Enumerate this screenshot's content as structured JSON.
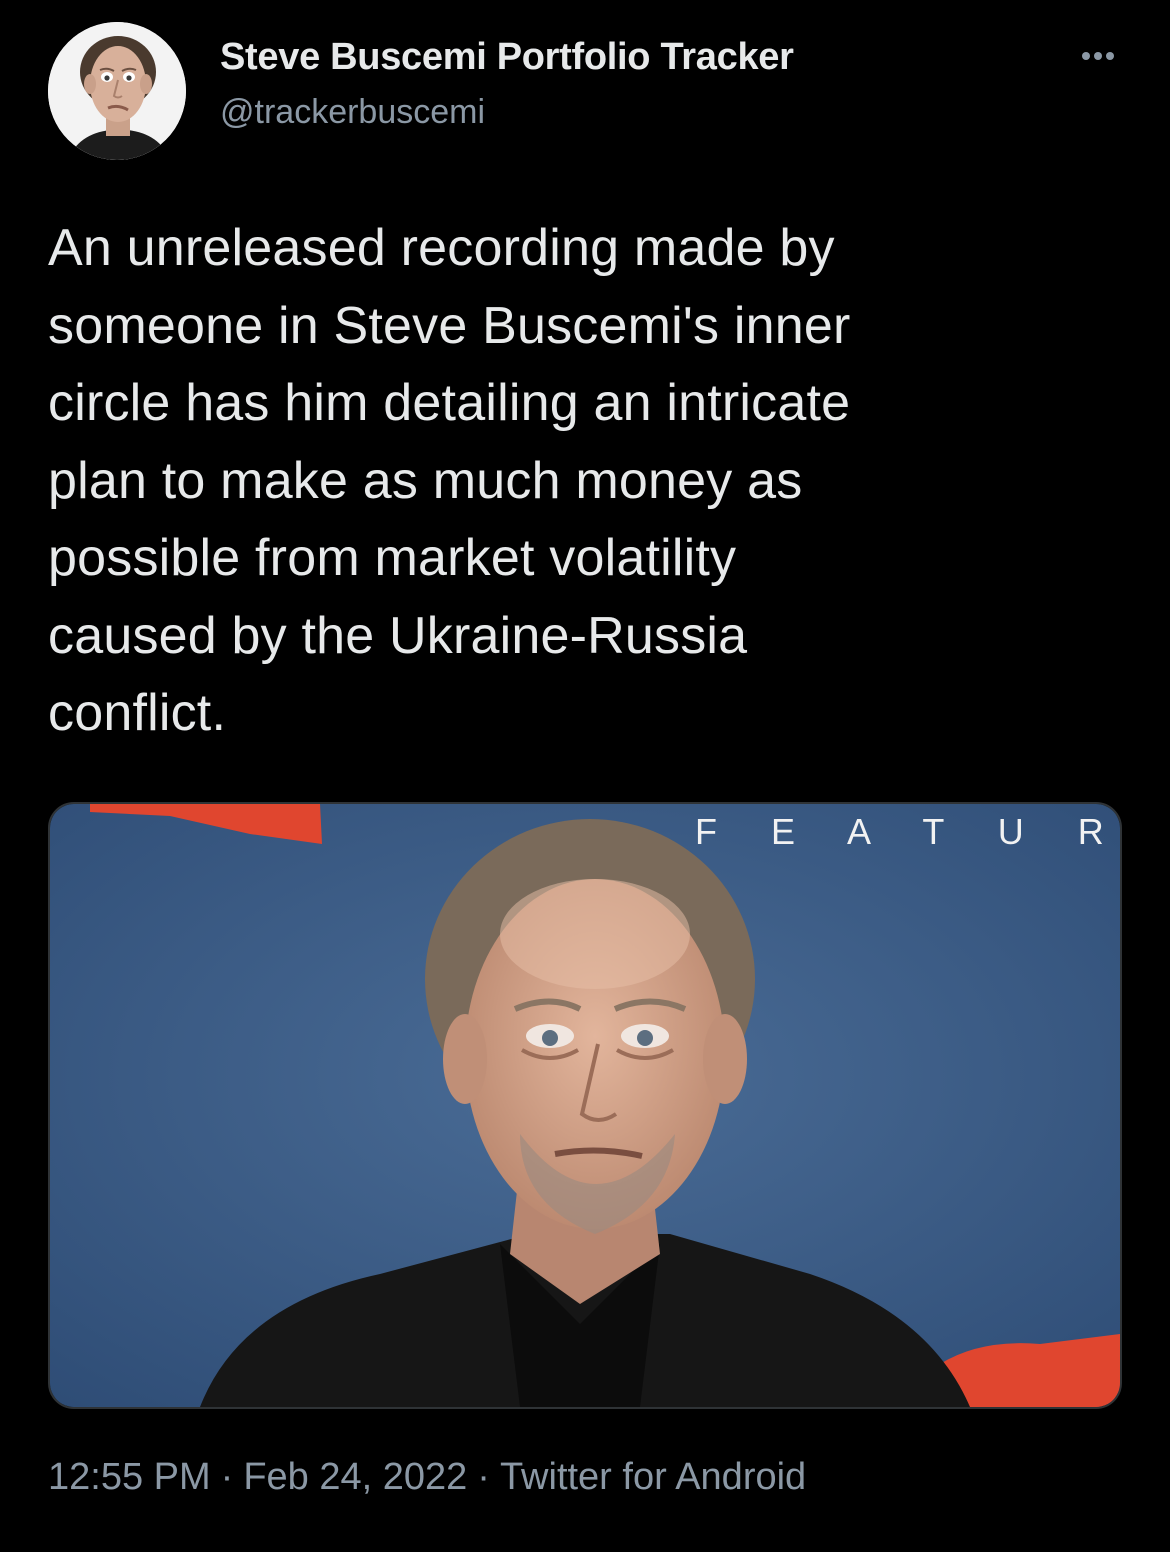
{
  "tweet": {
    "author": {
      "display_name": "Steve Buscemi Portfolio Tracker",
      "handle": "@trackerbuscemi",
      "avatar_icon": "profile-photo"
    },
    "more_icon": "more-options-icon",
    "text_lines": [
      "An unreleased recording made by",
      "someone in Steve Buscemi's inner",
      "circle has him detailing an intricate",
      "plan to make as much money as",
      "possible from market volatility",
      "caused by the Ukraine-Russia",
      "conflict."
    ],
    "media": {
      "backdrop_text": "F E A T U R E",
      "backdrop_color": "#3d5f8a",
      "accent_color": "#e0462f"
    },
    "meta": {
      "time": "12:55 PM",
      "separator": "·",
      "date": "Feb 24, 2022",
      "source": "Twitter for Android"
    }
  }
}
